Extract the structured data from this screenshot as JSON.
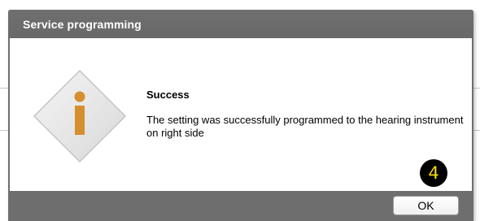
{
  "dialog": {
    "title": "Service programming",
    "message_title": "Success",
    "message_body": "The setting was successfully programmed to the hearing instrument on right side",
    "ok_label": "OK"
  },
  "icon": {
    "name": "info-diamond-icon",
    "fill": "#e6e6e6",
    "accent": "#d58f2f"
  },
  "step_badge": {
    "text": "4",
    "background": "#000000",
    "color": "#f5d800"
  }
}
